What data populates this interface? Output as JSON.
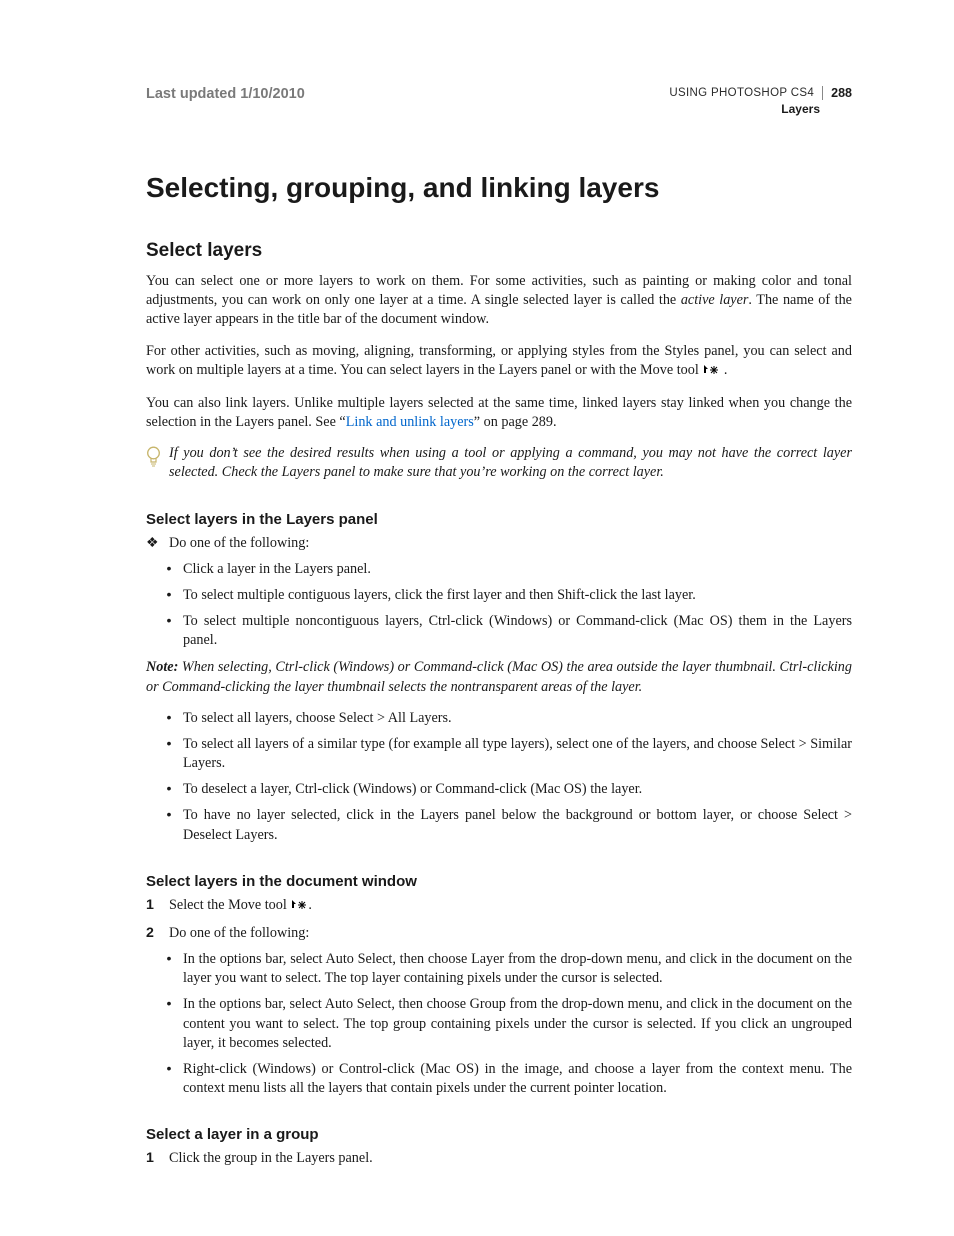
{
  "header": {
    "last_updated": "Last updated 1/10/2010",
    "book_title": "USING PHOTOSHOP CS4",
    "page_number": "288",
    "section": "Layers"
  },
  "h1": "Selecting, grouping, and linking layers",
  "h2": "Select layers",
  "p1a": "You can select one or more layers to work on them. For some activities, such as painting or making color and tonal adjustments, you can work on only one layer at a time. A single selected layer is called the ",
  "p1_active": "active layer",
  "p1b": ". The name of the active layer appears in the title bar of the document window.",
  "p2a": "For other activities, such as moving, aligning, transforming, or applying styles from the Styles panel, you can select and work on multiple layers at a time. You can select layers in the Layers panel or with the Move tool ",
  "p2b": " .",
  "p3a": "You can also link layers. Unlike multiple layers selected at the same time, linked layers stay linked when you change the selection in the Layers panel. See “",
  "p3_link": "Link and unlink layers",
  "p3b": "” on page 289.",
  "tip": "If you don’t see the desired results when using a tool or applying a command, you may not have the correct layer selected. Check the Layers panel to make sure that you’re working on the correct layer.",
  "h3a": "Select layers in the Layers panel",
  "secA": {
    "lead": "Do one of the following:",
    "b1": "Click a layer in the Layers panel.",
    "b2": "To select multiple contiguous layers, click the first layer and then Shift-click the last layer.",
    "b3": "To select multiple noncontiguous layers, Ctrl-click (Windows) or Command-click (Mac OS) them in the Layers panel.",
    "note_label": "Note:",
    "note_body": " When selecting, Ctrl-click (Windows) or Command-click (Mac OS) the area outside the layer thumbnail. Ctrl-clicking or Command-clicking the layer thumbnail selects the nontransparent areas of the layer.",
    "b4": "To select all layers, choose Select > All Layers.",
    "b5": "To select all layers of a similar type (for example all type layers), select one of the layers, and choose Select > Similar Layers.",
    "b6": "To deselect a layer, Ctrl-click (Windows) or Command-click (Mac OS) the layer.",
    "b7": "To have no layer selected, click in the Layers panel below the background or bottom layer, or choose Select > Deselect Layers."
  },
  "h3b": "Select layers in the document window",
  "secB": {
    "s1a": "Select the Move tool ",
    "s1b": ".",
    "s2": "Do one of the following:",
    "b1": "In the options bar, select Auto Select, then choose Layer from the drop-down menu, and click in the document on the layer you want to select. The top layer containing pixels under the cursor is selected.",
    "b2": "In the options bar, select Auto Select, then choose Group from the drop-down menu, and click in the document on the content you want to select. The top group containing pixels under the cursor is selected. If you click an ungrouped layer, it becomes selected.",
    "b3": "Right-click (Windows) or Control-click (Mac OS) in the image, and choose a layer from the context menu. The context menu lists all the layers that contain pixels under the current pointer location."
  },
  "h3c": "Select a layer in a group",
  "secC": {
    "s1": "Click the group in the Layers panel."
  },
  "markers": {
    "diamond": "❖",
    "dot": "•",
    "n1": "1",
    "n2": "2"
  }
}
